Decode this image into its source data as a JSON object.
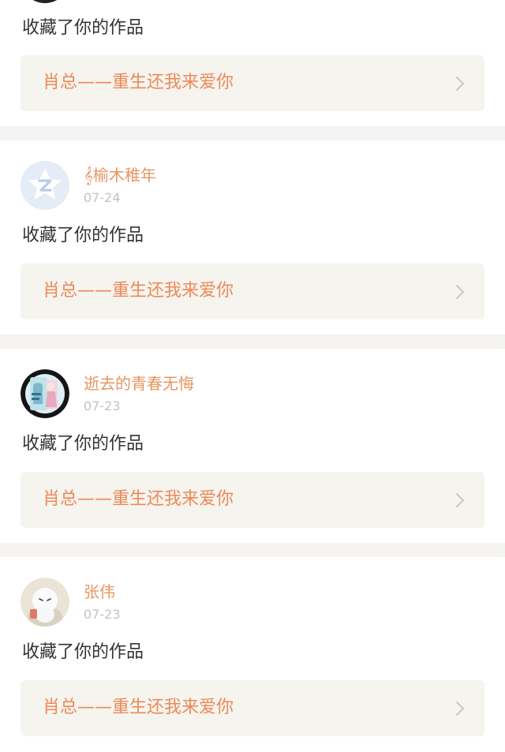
{
  "feed": {
    "items": [
      {
        "action_text": "收藏了你的作品",
        "work_title": "肖总——重生还我来爱你"
      },
      {
        "user_name": "𝄞榆木稚年",
        "date": "07-24",
        "action_text": "收藏了你的作品",
        "work_title": "肖总——重生还我来爱你",
        "avatar_icon": "qzone-star-icon"
      },
      {
        "user_name": "逝去的青春无悔",
        "date": "07-23",
        "action_text": "收藏了你的作品",
        "work_title": "肖总——重生还我来爱你",
        "avatar_icon": "anime-picture"
      },
      {
        "user_name": "张伟",
        "date": "07-23",
        "action_text": "收藏了你的作品",
        "work_title": "肖总——重生还我来爱你",
        "avatar_icon": "plush-toy-picture"
      }
    ]
  },
  "colors": {
    "accent": "#ec8a59",
    "username": "#e69663",
    "date": "#c2c2c2",
    "work_box_bg": "#f6f4ee",
    "separator": "#f6f4f3",
    "text": "#333333"
  }
}
